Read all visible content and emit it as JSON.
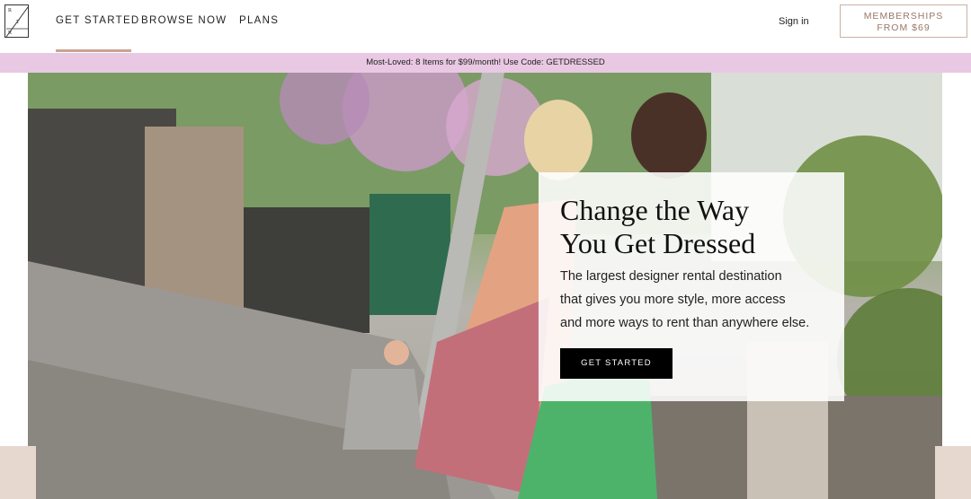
{
  "header": {
    "logo_letters": [
      "R",
      "T",
      "R"
    ],
    "nav": [
      {
        "label": "GET STARTED"
      },
      {
        "label": "BROWSE NOW"
      },
      {
        "label": "PLANS"
      }
    ],
    "signin_label": "Sign in",
    "memberships_button": {
      "line1": "MEMBERSHIPS",
      "line2": "FROM $69"
    }
  },
  "promo": {
    "text": "Most-Loved: 8 Items for $99/month! Use Code: GETDRESSED"
  },
  "hero": {
    "title_line1": "Change the Way",
    "title_line2": "You Get Dressed",
    "subtitle_lines": [
      "The largest designer rental destination",
      "that gives you more style, more access",
      "and more ways to rent than anywhere else."
    ],
    "cta_label": "GET STARTED"
  },
  "colors": {
    "promo_bg": "#e8c8e2",
    "accent_underline": "#c9a391",
    "memberships_text": "#9a7766",
    "cta_bg": "#000000"
  }
}
